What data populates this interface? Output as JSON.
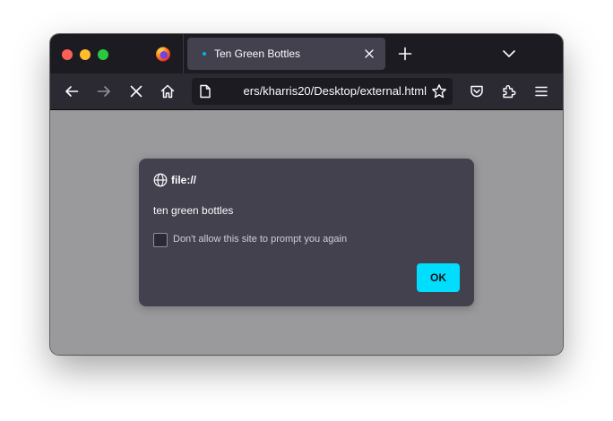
{
  "browser": {
    "tab": {
      "title": "Ten Green Bottles",
      "loading_indicator_color": "#00b3f4"
    },
    "url": "ers/kharris20/Desktop/external.html",
    "icons": {
      "logo": "firefox-logo-icon",
      "tab_close": "close-icon",
      "new_tab": "plus-icon",
      "tab_list": "chevron-down-icon",
      "back": "arrow-left-icon",
      "forward": "arrow-right-icon",
      "stop": "close-icon",
      "home": "home-icon",
      "page": "page-icon",
      "bookmark": "star-icon",
      "pocket": "pocket-icon",
      "extensions": "puzzle-icon",
      "menu": "hamburger-menu-icon"
    }
  },
  "dialog": {
    "origin": "file://",
    "message": "ten green bottles",
    "checkbox_label": "Don't allow this site to prompt you again",
    "checkbox_checked": false,
    "ok_label": "OK",
    "accent_color": "#00ddff",
    "icon": "globe-icon"
  }
}
